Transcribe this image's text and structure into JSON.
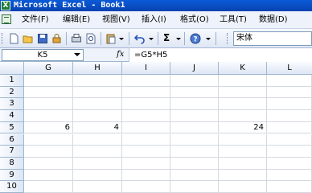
{
  "window": {
    "title": "Microsoft Excel - Book1",
    "app_icon_letter": "X"
  },
  "menu": [
    "文件(F)",
    "编辑(E)",
    "视图(V)",
    "插入(I)",
    "格式(O)",
    "工具(T)",
    "数据(D)"
  ],
  "toolbar": {
    "icons": [
      "new-icon",
      "open-icon",
      "save-icon",
      "permission-icon",
      "print-icon",
      "print-preview-icon",
      "paste-icon",
      "undo-icon",
      "autosum-icon",
      "help-icon"
    ],
    "autosum_label": "Σ",
    "font_name": "宋体"
  },
  "formula_bar": {
    "name_box": "K5",
    "fx_label": "fx",
    "formula": "=G5*H5"
  },
  "grid": {
    "columns": [
      "G",
      "H",
      "I",
      "J",
      "K",
      "L"
    ],
    "rows": [
      "1",
      "2",
      "3",
      "4",
      "5",
      "6",
      "7",
      "8",
      "9",
      "10"
    ],
    "cells": {
      "G5": "6",
      "H5": "4",
      "K5": "24"
    }
  }
}
